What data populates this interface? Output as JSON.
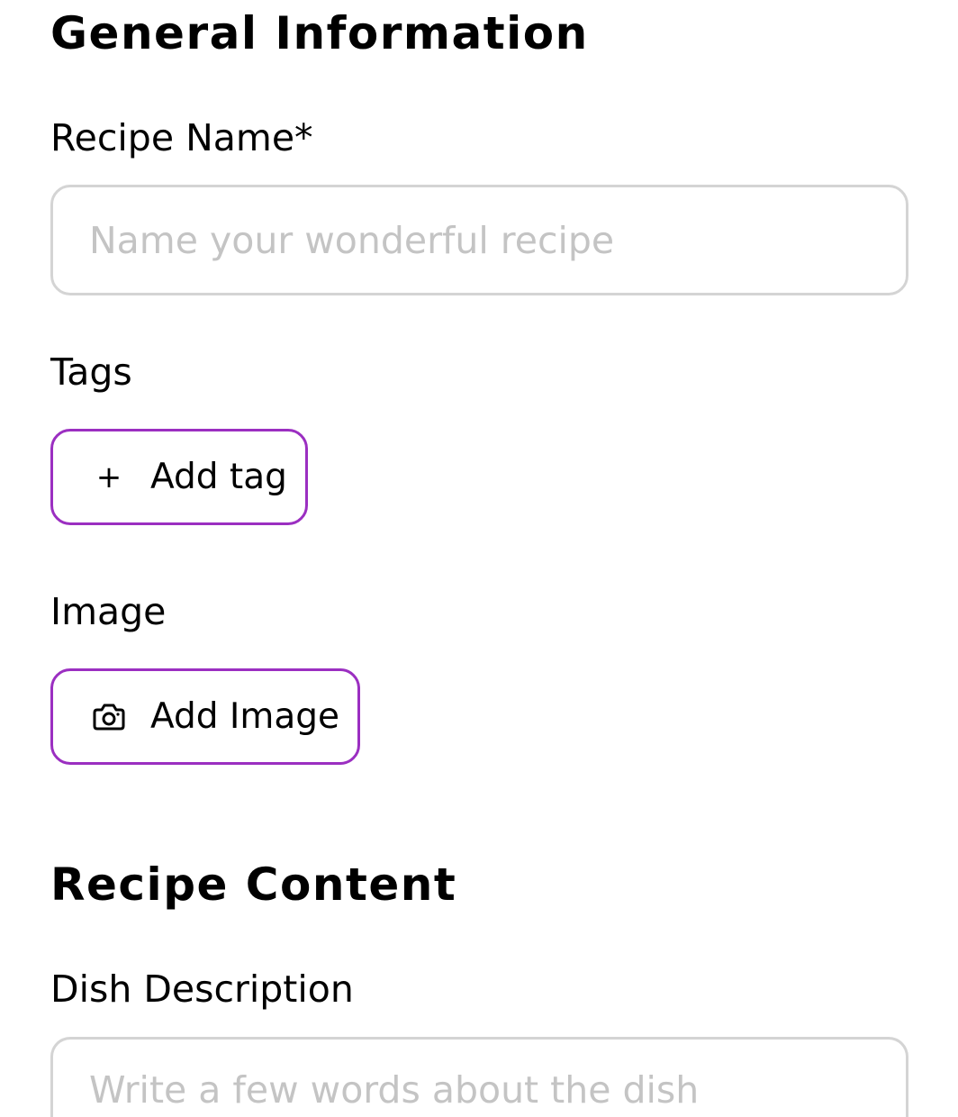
{
  "general_section": {
    "title": "General Information",
    "recipe_name": {
      "label": "Recipe Name*",
      "value": "",
      "placeholder": "Name your wonderful recipe"
    },
    "tags": {
      "label": "Tags",
      "add_button_label": "Add tag",
      "add_button_icon": "plus-icon"
    },
    "image": {
      "label": "Image",
      "add_button_label": "Add Image",
      "add_button_icon": "camera-icon"
    }
  },
  "content_section": {
    "title": "Recipe Content",
    "dish_description": {
      "label": "Dish Description",
      "value": "",
      "placeholder": "Write a few words about the dish"
    }
  },
  "colors": {
    "accent": "#9b2fc1",
    "input_border": "#d4d4d4",
    "placeholder": "#c4c4c4"
  }
}
